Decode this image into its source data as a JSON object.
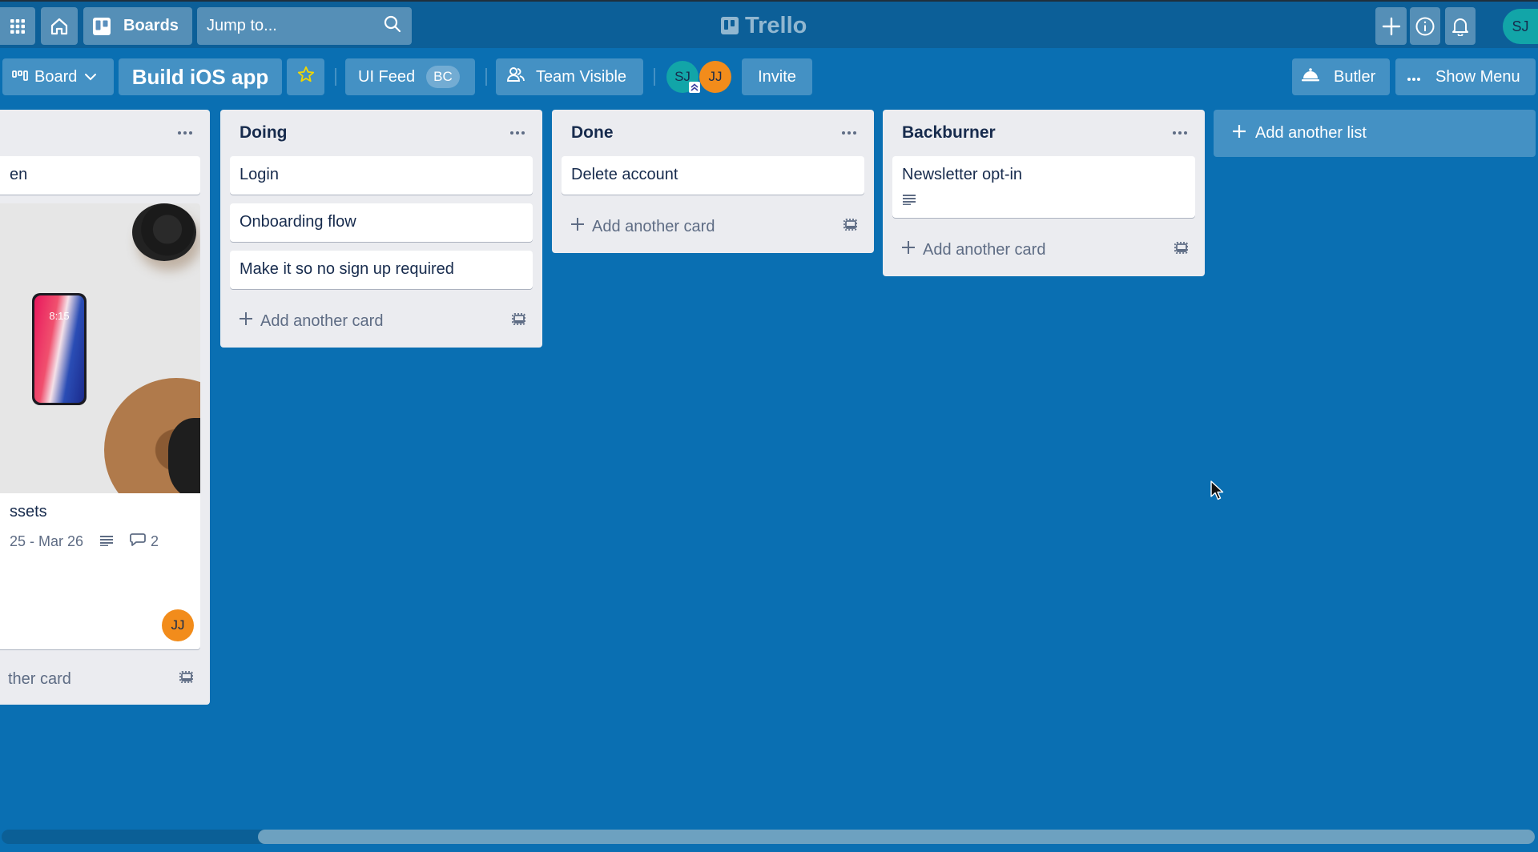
{
  "header": {
    "apps_icon": "apps-grid-icon",
    "home_icon": "home-icon",
    "boards_label": "Boards",
    "search_placeholder": "Jump to...",
    "logo_text": "Trello",
    "create_icon": "plus-icon",
    "info_icon": "info-icon",
    "notifications_icon": "bell-icon",
    "user_initials": "SJ"
  },
  "board_bar": {
    "view_label": "Board",
    "board_title": "Build iOS app",
    "team_label": "UI Feed",
    "team_badge": "BC",
    "visibility_label": "Team Visible",
    "members": [
      {
        "initials": "SJ",
        "color": "#12a5a8"
      },
      {
        "initials": "JJ",
        "color": "#f28c1b"
      }
    ],
    "invite_label": "Invite",
    "butler_label": "Butler",
    "menu_label": "Show Menu"
  },
  "lists": [
    {
      "title": "",
      "cards": [
        {
          "title": "en"
        },
        {
          "title": "ssets",
          "has_cover": true,
          "dates": "25 - Mar 26",
          "has_description": true,
          "comments": "2",
          "member": "JJ"
        }
      ],
      "add_card_label": "ther card"
    },
    {
      "title": "Doing",
      "cards": [
        {
          "title": "Login"
        },
        {
          "title": "Onboarding flow"
        },
        {
          "title": "Make it so no sign up required"
        }
      ],
      "add_card_label": "Add another card"
    },
    {
      "title": "Done",
      "cards": [
        {
          "title": "Delete account"
        }
      ],
      "add_card_label": "Add another card"
    },
    {
      "title": "Backburner",
      "cards": [
        {
          "title": "Newsletter opt-in",
          "has_description": true
        }
      ],
      "add_card_label": "Add another card"
    }
  ],
  "add_list_label": "Add another list",
  "colors": {
    "board_bg": "#0a6fb2",
    "header_bg": "#0c5f98",
    "list_bg": "#ebecf0",
    "accent_teal": "#12a5a8",
    "accent_orange": "#f28c1b",
    "star": "#f2d600"
  }
}
